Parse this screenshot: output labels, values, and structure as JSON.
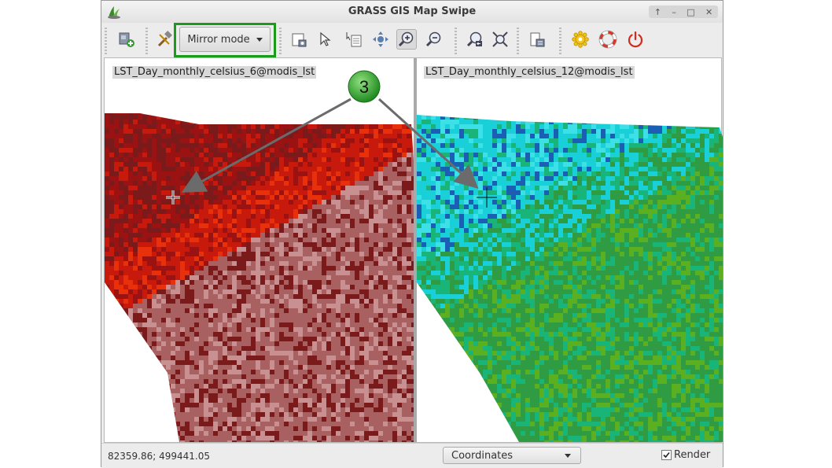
{
  "window": {
    "title": "GRASS GIS Map Swipe",
    "controls": [
      "↑",
      "–",
      "□",
      "✕"
    ]
  },
  "toolbar": {
    "mode_label": "Mirror mode",
    "tools": [
      {
        "name": "add-map-icon",
        "label": "Add map"
      },
      {
        "name": "tools-icon",
        "label": "Tools"
      },
      {
        "name": "render-map-icon",
        "label": "Render map"
      },
      {
        "name": "pointer-icon",
        "label": "Pointer"
      },
      {
        "name": "query-icon",
        "label": "Query"
      },
      {
        "name": "pan-icon",
        "label": "Pan"
      },
      {
        "name": "zoom-in-icon",
        "label": "Zoom in"
      },
      {
        "name": "zoom-out-icon",
        "label": "Zoom out"
      },
      {
        "name": "zoom-back-icon",
        "label": "Zoom back"
      },
      {
        "name": "zoom-extent-icon",
        "label": "Zoom to extent"
      },
      {
        "name": "save-image-icon",
        "label": "Save image"
      },
      {
        "name": "settings-icon",
        "label": "Settings"
      },
      {
        "name": "help-icon",
        "label": "Help"
      },
      {
        "name": "quit-icon",
        "label": "Quit"
      }
    ],
    "active_tool": "zoom-in-icon"
  },
  "maps": {
    "left_label": "LST_Day_monthly_celsius_6@modis_lst",
    "right_label": "LST_Day_monthly_celsius_12@modis_lst"
  },
  "annotation": {
    "badge": "3",
    "badge_color": "#2ea02e",
    "arrow_color": "#6b6b6b"
  },
  "statusbar": {
    "coordinates": "82359.86; 499441.05",
    "display_mode": "Coordinates",
    "render_label": "Render",
    "render_checked": true
  },
  "colors": {
    "highlight": "#1a9b1a",
    "left_palette": [
      "#7a1a1a",
      "#9b1212",
      "#c81a0c",
      "#e8300a",
      "#a86060",
      "#c89090"
    ],
    "right_palette": [
      "#1ad0d8",
      "#3ee0e8",
      "#1a5fb4",
      "#19b478",
      "#2f9c44",
      "#5ab020"
    ]
  }
}
